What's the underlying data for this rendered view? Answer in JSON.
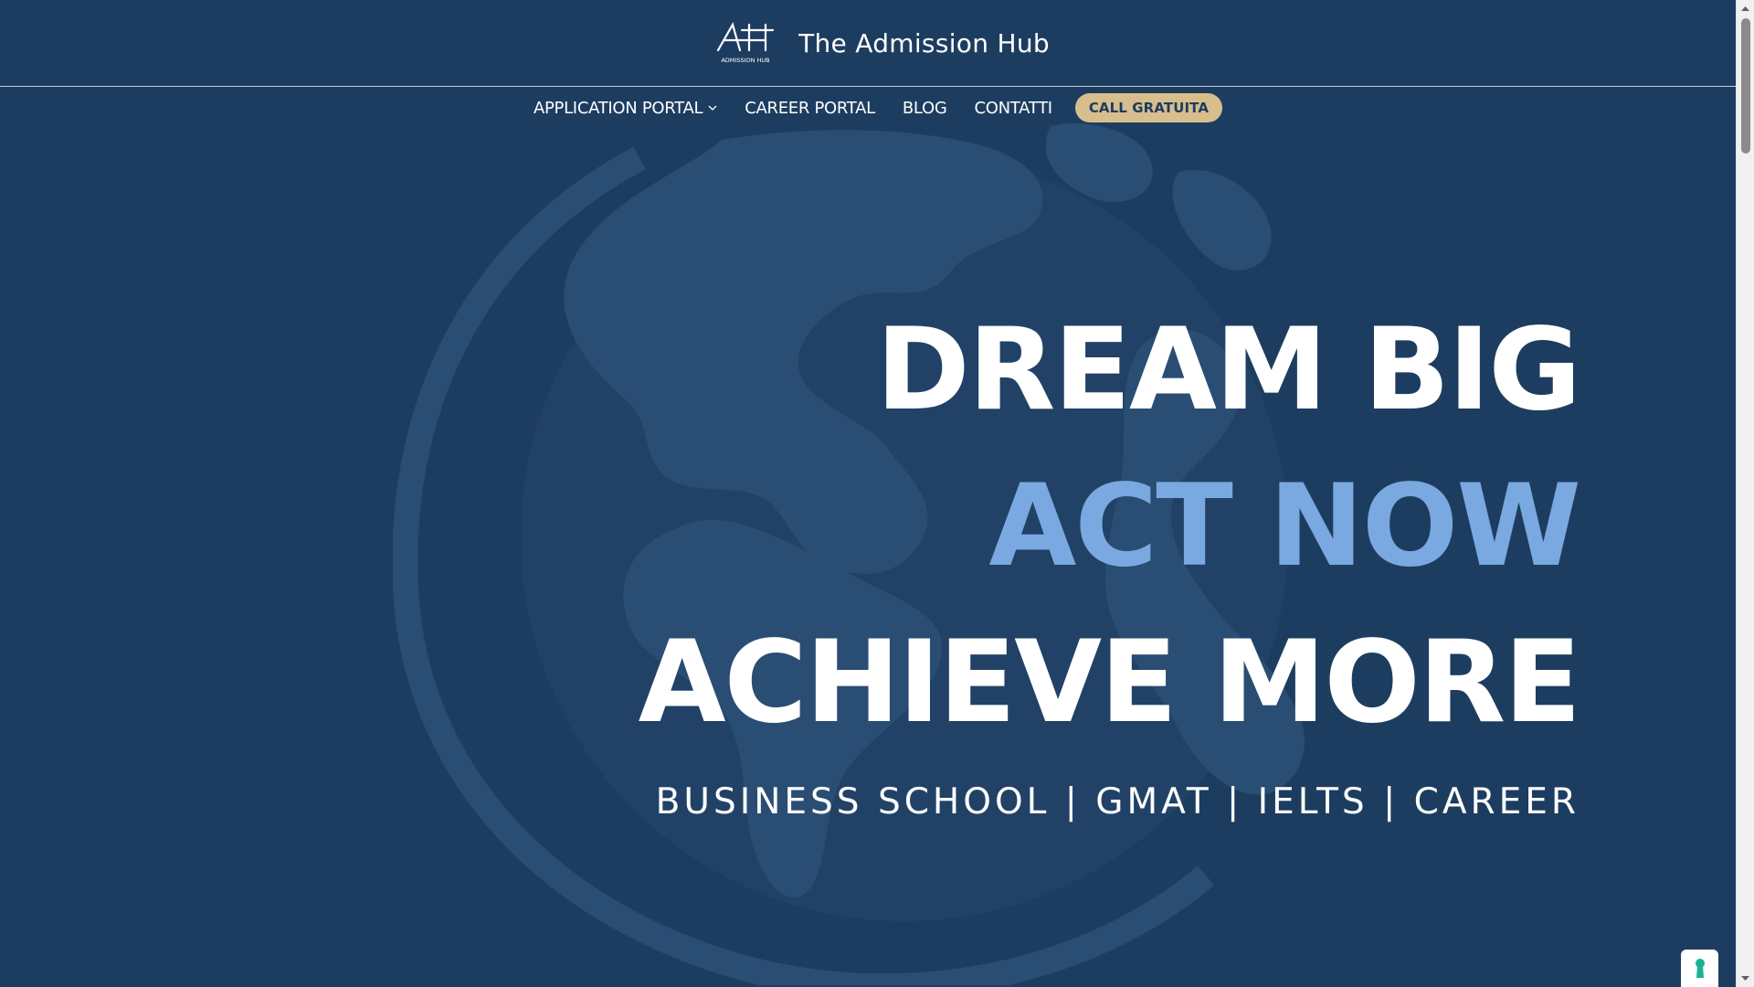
{
  "header": {
    "logo_alt": "AH",
    "logo_caption": "ADMISSION HUB",
    "brand_name": "The Admission Hub"
  },
  "nav": {
    "items": [
      {
        "label": "APPLICATION PORTAL",
        "has_dropdown": true
      },
      {
        "label": "CAREER PORTAL"
      },
      {
        "label": "BLOG"
      },
      {
        "label": "CONTATTI"
      }
    ],
    "cta_label": "CALL GRATUITA"
  },
  "hero": {
    "line1": "DREAM BIG",
    "line2": "ACT NOW",
    "line3": "ACHIEVE MORE",
    "subtitle": "BUSINESS SCHOOL | GMAT | IELTS | CAREER"
  },
  "colors": {
    "background": "#1d3d60",
    "accent": "#79a9e0",
    "cta": "#d8be8d",
    "privacy_icon": "#1ab394"
  },
  "icons": {
    "dropdown": "chevron-down-icon",
    "privacy": "keyhole-icon"
  }
}
